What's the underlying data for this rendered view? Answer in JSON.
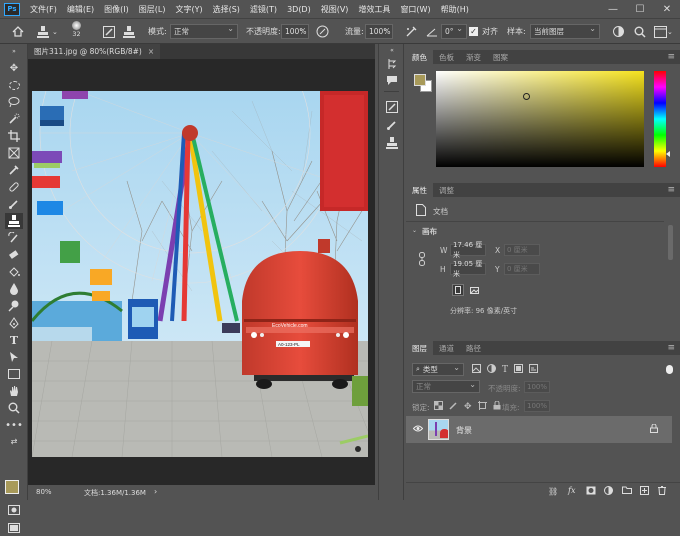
{
  "app": {
    "logo": "Ps"
  },
  "menu": [
    "文件(F)",
    "编辑(E)",
    "图像(I)",
    "图层(L)",
    "文字(Y)",
    "选择(S)",
    "滤镜(T)",
    "3D(D)",
    "视图(V)",
    "增效工具",
    "窗口(W)",
    "帮助(H)"
  ],
  "window_controls": {
    "minimize": "—",
    "maximize": "☐",
    "close": "✕"
  },
  "options": {
    "brush_size": "32",
    "mode_label": "模式:",
    "mode_value": "正常",
    "opacity_label": "不透明度:",
    "opacity_value": "100%",
    "flow_label": "流量:",
    "flow_value": "100%",
    "angle_value": "0°",
    "align_label": "对齐",
    "sample_label": "样本:",
    "sample_value": "当前图层"
  },
  "document": {
    "tab_title": "图片311.jpg @ 80%(RGB/8#)",
    "close": "×",
    "zoom": "80%",
    "doc_info": "文档:1.36M/1.36M"
  },
  "colors": {
    "foreground": "#a89a5a",
    "background": "#ffffff",
    "picker_hue": "#f5e21e",
    "accent": "#31a8ff"
  },
  "color_panel": {
    "tabs": [
      "颜色",
      "色板",
      "渐变",
      "图案"
    ]
  },
  "properties_panel": {
    "tabs": [
      "属性",
      "调整"
    ],
    "doc_label": "文档",
    "canvas_section": "画布",
    "w_label": "W",
    "w_value": "17.46 厘米",
    "x_label": "X",
    "x_value": "0 厘米",
    "h_label": "H",
    "h_value": "19.05 厘米",
    "y_label": "Y",
    "y_value": "0 厘米",
    "resolution": "分辨率: 96 像素/英寸"
  },
  "layers_panel": {
    "tabs": [
      "图层",
      "通道",
      "路径"
    ],
    "kind_value": "类型",
    "blend_value": "正常",
    "opacity_label": "不透明度:",
    "opacity_value": "100%",
    "lock_label": "锁定:",
    "fill_label": "填充:",
    "fill_value": "100%",
    "layer_name": "背景"
  },
  "bus_sign": "EcoVehicle.com",
  "bus_plate": "A0-123-PL"
}
